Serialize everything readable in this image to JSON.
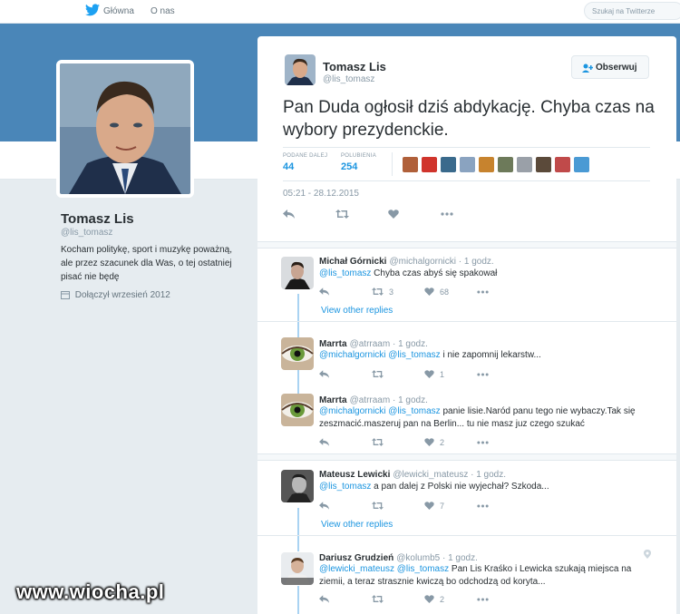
{
  "topbar": {
    "home_label": "Główna",
    "about_label": "O nas",
    "search_placeholder": "Szukaj na Twitterze"
  },
  "profile": {
    "name": "Tomasz Lis",
    "handle": "@lis_tomasz",
    "bio": "Kocham politykę, sport i muzykę poważną, ale przez szacunek dla Was, o tej ostatniej pisać nie będę",
    "joined": "Dołączył wrzesień 2012"
  },
  "main_tweet": {
    "name": "Tomasz Lis",
    "handle": "@lis_tomasz",
    "follow_label": "Obserwuj",
    "text": "Pan Duda ogłosił dziś abdykację. Chyba czas na wybory prezydenckie.",
    "retweets_label": "PODANE DALEJ",
    "retweets": "44",
    "likes_label": "POLUBIENIA",
    "likes": "254",
    "date": "05:21 - 28.12.2015",
    "liker_colors": [
      "#b0603a",
      "#d0342c",
      "#3a6a8c",
      "#8aa3c0",
      "#c7832e",
      "#6d7a5a",
      "#9aa0a8",
      "#5b4a3a",
      "#c04a4a",
      "#4a9ad4"
    ]
  },
  "replies": [
    {
      "name": "Michał Górnicki",
      "handle": "@michalgornicki",
      "time": "· 1 godz.",
      "mentions": "@lis_tomasz",
      "text": " Chyba czas abyś się spakował",
      "retweets": "3",
      "likes": "68",
      "view_replies": "View other replies"
    },
    {
      "name": "Marrta",
      "handle": "@atrraam",
      "time": "· 1 godz.",
      "mentions": "@michalgornicki @lis_tomasz",
      "text": " i nie zapomnij lekarstw...",
      "retweets": "",
      "likes": "1"
    },
    {
      "name": "Marrta",
      "handle": "@atrraam",
      "time": "· 1 godz.",
      "mentions": "@michalgornicki @lis_tomasz",
      "text": " panie lisie.Naród panu tego nie wybaczy.Tak się",
      "text2": "zeszmacić.maszeruj pan na Berlin... tu nie masz juz czego szukać",
      "retweets": "",
      "likes": "2"
    },
    {
      "name": "Mateusz Lewicki",
      "handle": "@lewicki_mateusz",
      "time": "· 1 godz.",
      "mentions": "@lis_tomasz",
      "text": " a pan dalej z Polski nie wyjechał? Szkoda...",
      "retweets": "",
      "likes": "7",
      "view_replies": "View other replies"
    },
    {
      "name": "Dariusz Grudzień",
      "handle": "@kolumb5",
      "time": "· 1 godz.",
      "mentions": "@lewicki_mateusz @lis_tomasz",
      "text": " Pan Lis Kraśko i Lewicka szukają miejsca na",
      "text2": "ziemii, a teraz strasznie kwiczą bo odchodzą od koryta...",
      "retweets": "",
      "likes": "2"
    }
  ],
  "watermark": "www.wiocha.pl",
  "colors": {
    "accent": "#1b95e0",
    "banner": "#4a86b8",
    "thread": "#a9d3f2"
  }
}
